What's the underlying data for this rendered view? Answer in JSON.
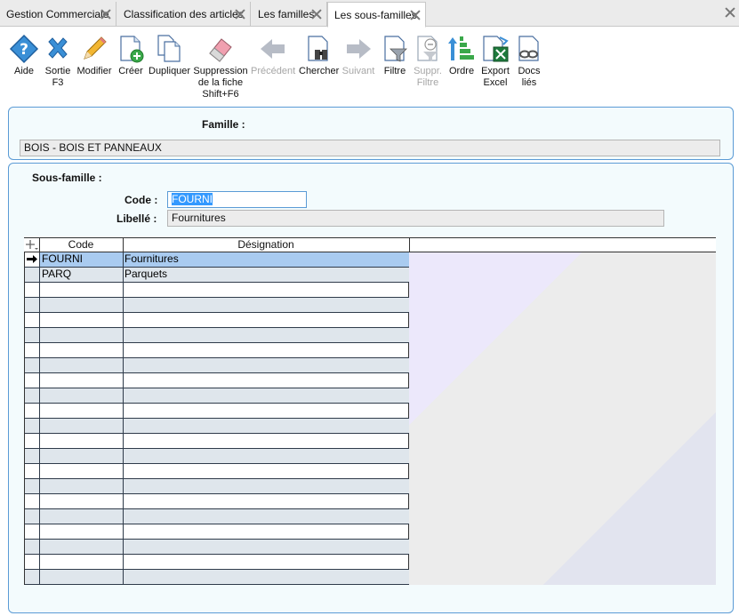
{
  "tabs": [
    {
      "label": "Gestion Commerciale",
      "active": false
    },
    {
      "label": "Classification des articles",
      "active": false
    },
    {
      "label": "Les familles",
      "active": false
    },
    {
      "label": "Les sous-familles",
      "active": true
    }
  ],
  "toolbar": {
    "aide": "Aide",
    "sortie": [
      "Sortie",
      "F3"
    ],
    "modifier": "Modifier",
    "creer": "Créer",
    "dupliquer": "Dupliquer",
    "suppression": [
      "Suppression",
      "de la fiche",
      "Shift+F6"
    ],
    "precedent": "Précédent",
    "chercher": "Chercher",
    "suivant": "Suivant",
    "filtre": "Filtre",
    "suppr_filtre": [
      "Suppr.",
      "Filtre"
    ],
    "ordre": "Ordre",
    "export": [
      "Export",
      "Excel"
    ],
    "docs": [
      "Docs",
      "liés"
    ]
  },
  "famille": {
    "label": "Famille :",
    "value": "BOIS - BOIS ET PANNEAUX"
  },
  "sous_famille": {
    "label": "Sous-famille :",
    "code_label": "Code :",
    "code_value": "FOURNI",
    "libelle_label": "Libellé :",
    "libelle_value": "Fournitures"
  },
  "grid": {
    "columns": [
      "Code",
      "Désignation"
    ],
    "rows": [
      {
        "code": "FOURNI",
        "designation": "Fournitures",
        "current": true
      },
      {
        "code": "PARQ",
        "designation": "Parquets",
        "current": false
      }
    ]
  },
  "colors": {
    "accent": "#5b9bd5",
    "selection": "#a9cbf0",
    "alt_row": "#dfe6ec"
  }
}
